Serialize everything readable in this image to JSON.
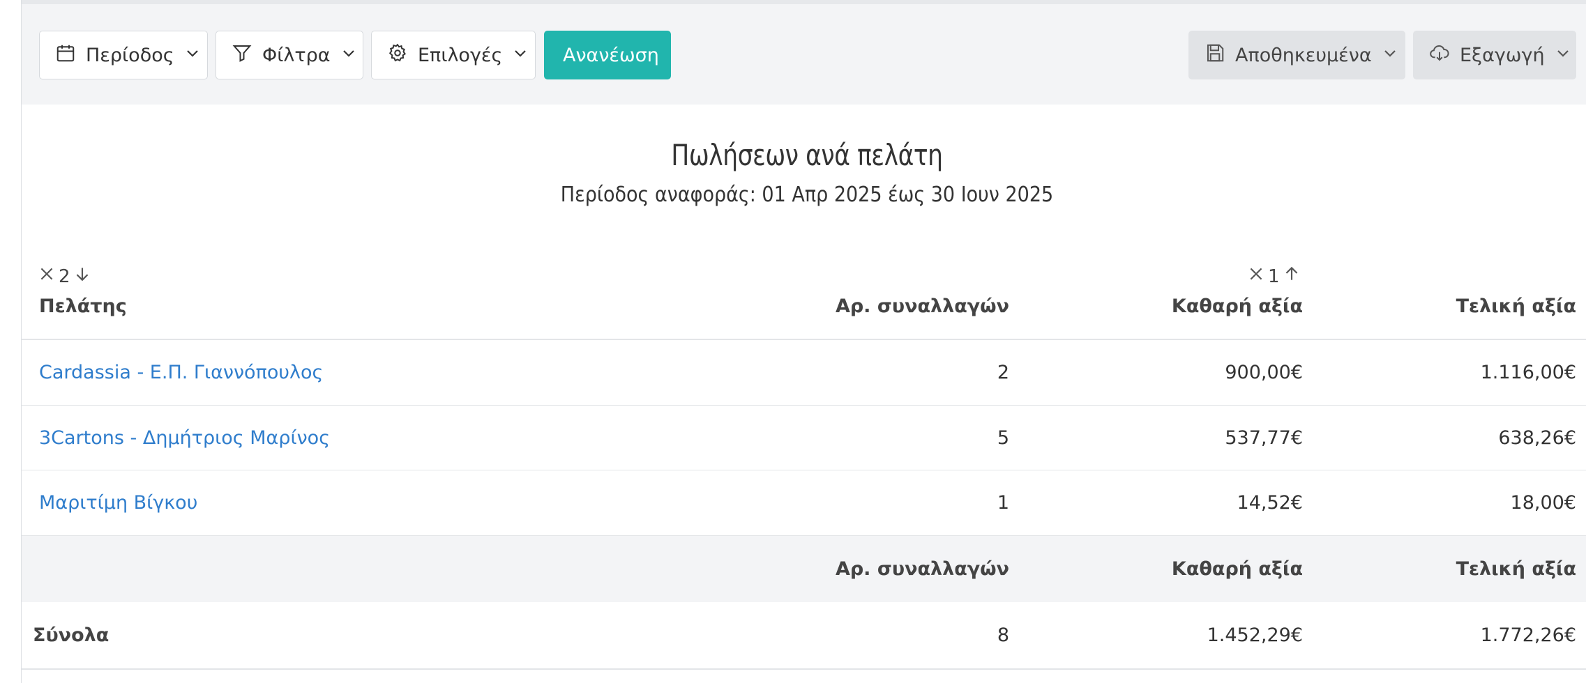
{
  "toolbar": {
    "period_label": "Περίοδος",
    "filters_label": "Φίλτρα",
    "options_label": "Επιλογές",
    "refresh_label": "Ανανέωση",
    "saved_label": "Αποθηκευμένα",
    "export_label": "Εξαγωγή"
  },
  "report": {
    "title": "Πωλήσεων ανά πελάτη",
    "subtitle": "Περίοδος αναφοράς: 01 Απρ 2025 έως 30 Ιουν 2025"
  },
  "sort": {
    "customer_order": "2",
    "net_order": "1"
  },
  "columns": {
    "customer": "Πελάτης",
    "transactions": "Αρ. συναλλαγών",
    "net": "Καθαρή αξία",
    "total": "Τελική αξία"
  },
  "rows": [
    {
      "customer": "Cardassia - Ε.Π. Γιαννόπουλος",
      "transactions": "2",
      "net": "900,00€",
      "total": "1.116,00€"
    },
    {
      "customer": "3Cartons - Δημήτριος Μαρίνος",
      "transactions": "5",
      "net": "537,77€",
      "total": "638,26€"
    },
    {
      "customer": "Μαριτίμη Βίγκου",
      "transactions": "1",
      "net": "14,52€",
      "total": "18,00€"
    }
  ],
  "footer": {
    "transactions": "Αρ. συναλλαγών",
    "net": "Καθαρή αξία",
    "total": "Τελική αξία"
  },
  "totals": {
    "label": "Σύνολα",
    "transactions": "8",
    "net": "1.452,29€",
    "total": "1.772,26€"
  },
  "colors": {
    "accent": "#21b5ad",
    "link": "#2f7dcc"
  }
}
